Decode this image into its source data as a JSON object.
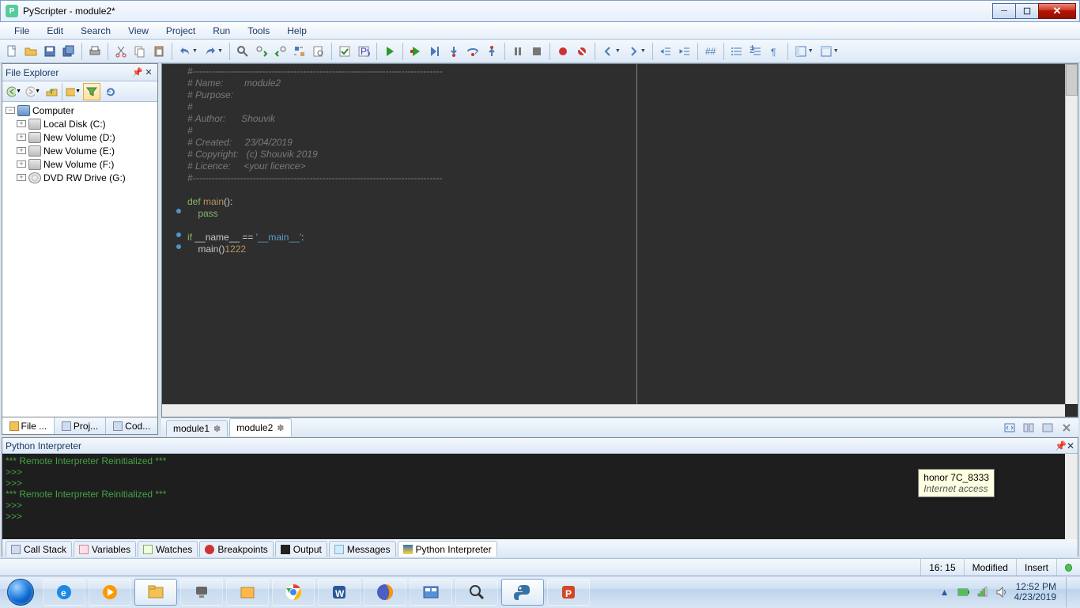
{
  "titlebar": {
    "title": "PyScripter - module2*"
  },
  "menu": {
    "items": [
      "File",
      "Edit",
      "Search",
      "View",
      "Project",
      "Run",
      "Tools",
      "Help"
    ]
  },
  "file_explorer": {
    "title": "File Explorer",
    "tree": {
      "root": "Computer",
      "items": [
        "Local Disk (C:)",
        "New Volume (D:)",
        "New Volume (E:)",
        "New Volume (F:)",
        "DVD RW Drive (G:)"
      ]
    },
    "bottom_tabs": [
      "File ...",
      "Proj...",
      "Cod..."
    ]
  },
  "editor": {
    "tabs": [
      {
        "label": "module1",
        "dirty": true,
        "active": false
      },
      {
        "label": "module2",
        "dirty": true,
        "active": true
      }
    ],
    "header_lines": [
      "#-------------------------------------------------------------------------------",
      "# Name:        module2",
      "# Purpose:",
      "#",
      "# Author:      Shouvik",
      "#",
      "# Created:     23/04/2019",
      "# Copyright:   (c) Shouvik 2019",
      "# Licence:     <your licence>",
      "#-------------------------------------------------------------------------------"
    ],
    "code": {
      "l11": "",
      "l12_def": "def ",
      "l12_main": "main",
      "l12_rest": "():",
      "l13": "    pass",
      "l14": "",
      "l15_if": "if ",
      "l15_name": "__name__",
      "l15_eq": " == ",
      "l15_str": "'__main__'",
      "l15_colon": ":",
      "l16_call": "    main()",
      "l16_num": "1222"
    }
  },
  "interpreter": {
    "title": "Python Interpreter",
    "lines": [
      "*** Remote Interpreter Reinitialized  ***",
      ">>>",
      ">>>",
      "*** Remote Interpreter Reinitialized  ***",
      ">>>",
      ">>>"
    ],
    "tabs": [
      "Call Stack",
      "Variables",
      "Watches",
      "Breakpoints",
      "Output",
      "Messages",
      "Python Interpreter"
    ]
  },
  "status": {
    "cursor": "16: 15",
    "state": "Modified",
    "mode": "Insert"
  },
  "tooltip": {
    "line1": "honor 7C_8333",
    "line2": "Internet access"
  },
  "tray": {
    "time": "12:52 PM",
    "date": "4/23/2019"
  }
}
